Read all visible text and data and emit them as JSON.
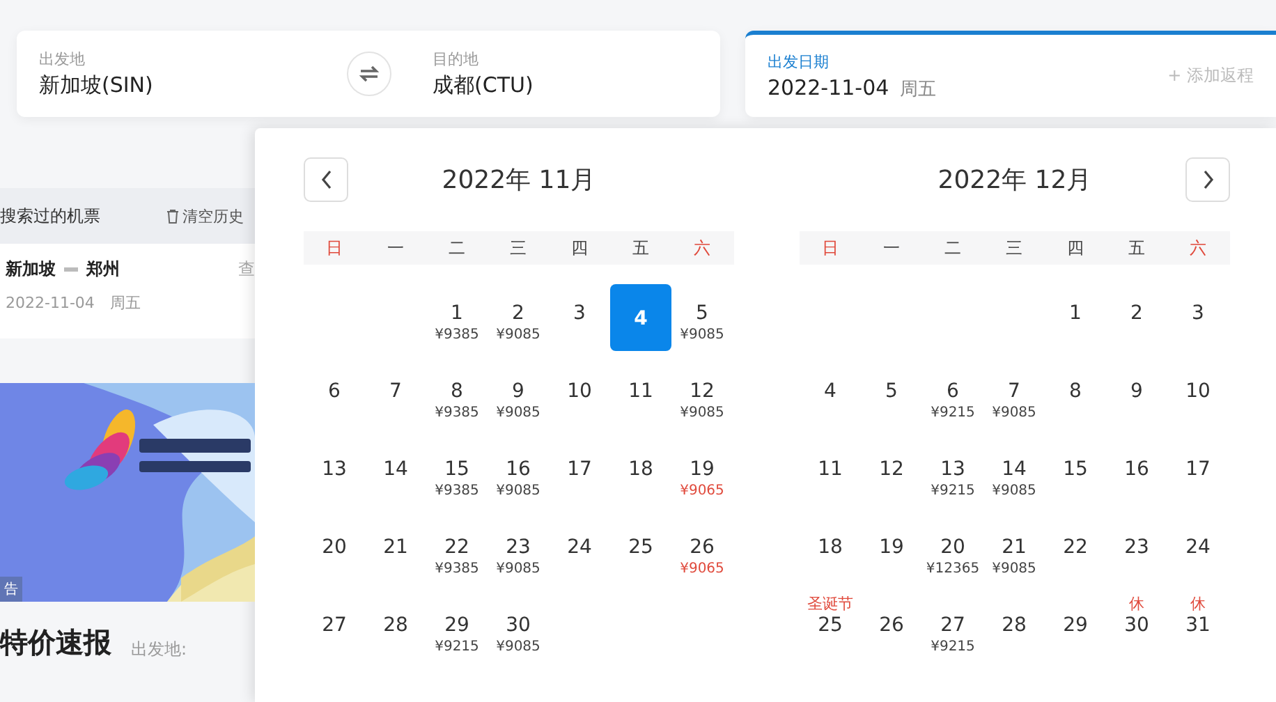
{
  "search_bar": {
    "origin": {
      "label": "出发地",
      "value": "新加坡(SIN)"
    },
    "destination": {
      "label": "目的地",
      "value": "成都(CTU)"
    },
    "date": {
      "label": "出发日期",
      "value": "2022-11-04",
      "weekday": "周五",
      "add_return": "+ 添加返程"
    }
  },
  "history": {
    "title": "搜索过的机票",
    "clear": "清空历史",
    "items": [
      {
        "from": "新加坡",
        "to": "郑州",
        "date": "2022-11-04",
        "weekday": "周五",
        "action": "查"
      }
    ]
  },
  "ad": {
    "kind": "picture",
    "badge": "告"
  },
  "deals": {
    "title": "特价速报",
    "origin_label": "出发地:"
  },
  "calendar": {
    "months": [
      {
        "title": "2022年 11月",
        "nav": {
          "kind": "prev"
        },
        "weekdays": [
          {
            "label": "日",
            "weekend": true
          },
          {
            "label": "一",
            "weekend": false
          },
          {
            "label": "二",
            "weekend": false
          },
          {
            "label": "三",
            "weekend": false
          },
          {
            "label": "四",
            "weekend": false
          },
          {
            "label": "五",
            "weekend": false
          },
          {
            "label": "六",
            "weekend": true
          }
        ],
        "days": [
          {
            "kind": "blank"
          },
          {
            "kind": "blank"
          },
          {
            "kind": "day",
            "day": "1",
            "price": "¥9385",
            "low_price": false,
            "selected": false
          },
          {
            "kind": "day",
            "day": "2",
            "price": "¥9085",
            "low_price": false,
            "selected": false
          },
          {
            "kind": "day",
            "day": "3",
            "selected": false
          },
          {
            "kind": "day",
            "day": "4",
            "selected": true
          },
          {
            "kind": "day",
            "day": "5",
            "price": "¥9085",
            "low_price": false,
            "selected": false
          },
          {
            "kind": "day",
            "day": "6",
            "selected": false
          },
          {
            "kind": "day",
            "day": "7",
            "selected": false
          },
          {
            "kind": "day",
            "day": "8",
            "price": "¥9385",
            "low_price": false,
            "selected": false
          },
          {
            "kind": "day",
            "day": "9",
            "price": "¥9085",
            "low_price": false,
            "selected": false
          },
          {
            "kind": "day",
            "day": "10",
            "selected": false
          },
          {
            "kind": "day",
            "day": "11",
            "selected": false
          },
          {
            "kind": "day",
            "day": "12",
            "price": "¥9085",
            "low_price": false,
            "selected": false
          },
          {
            "kind": "day",
            "day": "13",
            "selected": false
          },
          {
            "kind": "day",
            "day": "14",
            "selected": false
          },
          {
            "kind": "day",
            "day": "15",
            "price": "¥9385",
            "low_price": false,
            "selected": false
          },
          {
            "kind": "day",
            "day": "16",
            "price": "¥9085",
            "low_price": false,
            "selected": false
          },
          {
            "kind": "day",
            "day": "17",
            "selected": false
          },
          {
            "kind": "day",
            "day": "18",
            "selected": false
          },
          {
            "kind": "day",
            "day": "19",
            "price": "¥9065",
            "low_price": true,
            "selected": false
          },
          {
            "kind": "day",
            "day": "20",
            "selected": false
          },
          {
            "kind": "day",
            "day": "21",
            "selected": false
          },
          {
            "kind": "day",
            "day": "22",
            "price": "¥9385",
            "low_price": false,
            "selected": false
          },
          {
            "kind": "day",
            "day": "23",
            "price": "¥9085",
            "low_price": false,
            "selected": false
          },
          {
            "kind": "day",
            "day": "24",
            "selected": false
          },
          {
            "kind": "day",
            "day": "25",
            "selected": false
          },
          {
            "kind": "day",
            "day": "26",
            "price": "¥9065",
            "low_price": true,
            "selected": false
          },
          {
            "kind": "day",
            "day": "27",
            "selected": false
          },
          {
            "kind": "day",
            "day": "28",
            "selected": false
          },
          {
            "kind": "day",
            "day": "29",
            "price": "¥9215",
            "low_price": false,
            "selected": false
          },
          {
            "kind": "day",
            "day": "30",
            "price": "¥9085",
            "low_price": false,
            "selected": false
          }
        ]
      },
      {
        "title": "2022年 12月",
        "nav": {
          "kind": "next"
        },
        "weekdays": [
          {
            "label": "日",
            "weekend": true
          },
          {
            "label": "一",
            "weekend": false
          },
          {
            "label": "二",
            "weekend": false
          },
          {
            "label": "三",
            "weekend": false
          },
          {
            "label": "四",
            "weekend": false
          },
          {
            "label": "五",
            "weekend": false
          },
          {
            "label": "六",
            "weekend": true
          }
        ],
        "days": [
          {
            "kind": "blank"
          },
          {
            "kind": "blank"
          },
          {
            "kind": "blank"
          },
          {
            "kind": "blank"
          },
          {
            "kind": "day",
            "day": "1",
            "selected": false
          },
          {
            "kind": "day",
            "day": "2",
            "selected": false
          },
          {
            "kind": "day",
            "day": "3",
            "selected": false
          },
          {
            "kind": "day",
            "day": "4",
            "selected": false
          },
          {
            "kind": "day",
            "day": "5",
            "selected": false
          },
          {
            "kind": "day",
            "day": "6",
            "price": "¥9215",
            "low_price": false,
            "selected": false
          },
          {
            "kind": "day",
            "day": "7",
            "price": "¥9085",
            "low_price": false,
            "selected": false
          },
          {
            "kind": "day",
            "day": "8",
            "selected": false
          },
          {
            "kind": "day",
            "day": "9",
            "selected": false
          },
          {
            "kind": "day",
            "day": "10",
            "selected": false
          },
          {
            "kind": "day",
            "day": "11",
            "selected": false
          },
          {
            "kind": "day",
            "day": "12",
            "selected": false
          },
          {
            "kind": "day",
            "day": "13",
            "price": "¥9215",
            "low_price": false,
            "selected": false
          },
          {
            "kind": "day",
            "day": "14",
            "price": "¥9085",
            "low_price": false,
            "selected": false
          },
          {
            "kind": "day",
            "day": "15",
            "selected": false
          },
          {
            "kind": "day",
            "day": "16",
            "selected": false
          },
          {
            "kind": "day",
            "day": "17",
            "selected": false
          },
          {
            "kind": "day",
            "day": "18",
            "selected": false
          },
          {
            "kind": "day",
            "day": "19",
            "selected": false
          },
          {
            "kind": "day",
            "day": "20",
            "price": "¥12365",
            "low_price": false,
            "selected": false
          },
          {
            "kind": "day",
            "day": "21",
            "price": "¥9085",
            "low_price": false,
            "selected": false
          },
          {
            "kind": "day",
            "day": "22",
            "selected": false
          },
          {
            "kind": "day",
            "day": "23",
            "selected": false
          },
          {
            "kind": "day",
            "day": "24",
            "selected": false
          },
          {
            "kind": "day",
            "day": "25",
            "note": "圣诞节",
            "selected": false
          },
          {
            "kind": "day",
            "day": "26",
            "selected": false
          },
          {
            "kind": "day",
            "day": "27",
            "price": "¥9215",
            "low_price": false,
            "selected": false
          },
          {
            "kind": "day",
            "day": "28",
            "selected": false
          },
          {
            "kind": "day",
            "day": "29",
            "selected": false
          },
          {
            "kind": "day",
            "day": "30",
            "note": "休",
            "selected": false
          },
          {
            "kind": "day",
            "day": "31",
            "note": "休",
            "selected": false
          }
        ]
      }
    ]
  }
}
